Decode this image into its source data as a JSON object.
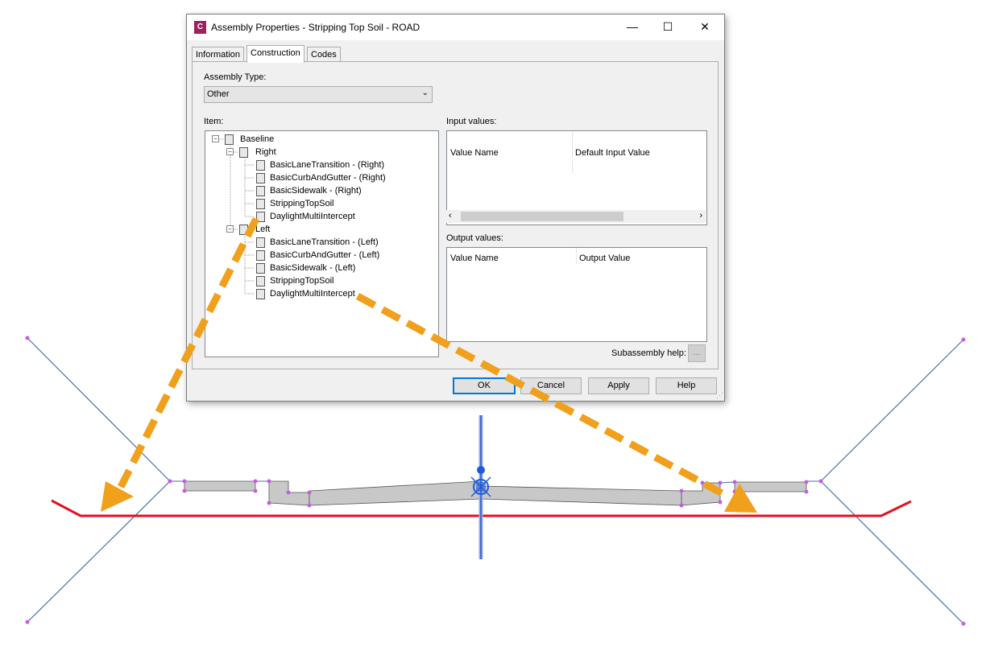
{
  "window": {
    "title": "Assembly Properties - Stripping Top Soil - ROAD",
    "app_icon_letter": "C",
    "minimize": "—",
    "maximize": "☐",
    "close": "✕"
  },
  "tabs": [
    {
      "label": "Information",
      "active": false
    },
    {
      "label": "Construction",
      "active": true
    },
    {
      "label": "Codes",
      "active": false
    }
  ],
  "assembly_type": {
    "label": "Assembly Type:",
    "value": "Other"
  },
  "item": {
    "label": "Item:",
    "tree": {
      "baseline": "Baseline",
      "right": "Right",
      "right_children": [
        "BasicLaneTransition - (Right)",
        "BasicCurbAndGutter - (Right)",
        "BasicSidewalk - (Right)",
        "StrippingTopSoil",
        "DaylightMultiIntercept"
      ],
      "left": "Left",
      "left_children": [
        "BasicLaneTransition - (Left)",
        "BasicCurbAndGutter - (Left)",
        "BasicSidewalk - (Left)",
        "StrippingTopSoil",
        "DaylightMultiIntercept"
      ]
    }
  },
  "input_values": {
    "label": "Input values:",
    "columns": [
      "Value Name",
      "Default Input Value"
    ]
  },
  "output_values": {
    "label": "Output values:",
    "columns": [
      "Value Name",
      "Output Value"
    ]
  },
  "subassembly_help": {
    "label": "Subassembly help:",
    "button": "..."
  },
  "buttons": {
    "ok": "OK",
    "cancel": "Cancel",
    "apply": "Apply",
    "help": "Help"
  },
  "colors": {
    "daylight_line": "#4a6fa0",
    "datum_line": "#e01020",
    "arrow": "#f0a01a",
    "vertex": "#c060e0",
    "subassembly_fill": "#c8c8c8",
    "baseline_marker": "#1e5bd8"
  }
}
